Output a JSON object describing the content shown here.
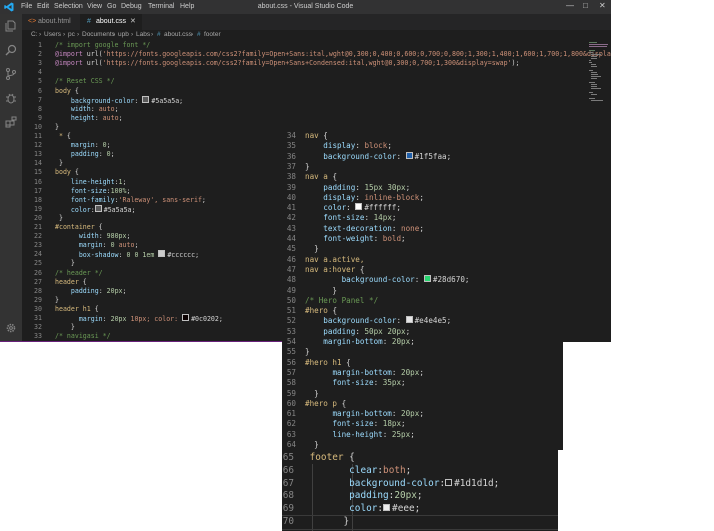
{
  "window": {
    "title": "about.css - Visual Studio Code",
    "menu": [
      "File",
      "Edit",
      "Selection",
      "View",
      "Go",
      "Debug",
      "Terminal",
      "Help"
    ]
  },
  "tabs": [
    {
      "label": "about.html",
      "icon": "html-file-icon",
      "active": false
    },
    {
      "label": "about.css",
      "icon": "css-file-icon",
      "active": true
    }
  ],
  "breadcrumb": [
    "C:",
    "Users",
    "pc",
    "Documents",
    "upb",
    "Labs",
    "about.css",
    "footer"
  ],
  "colors": {
    "accent": "#007acc",
    "background": "#1e1e1e",
    "swatch_5a5a5a": "#5a5a5a",
    "swatch_cccccc": "#cccccc",
    "swatch_0c0202": "#0c0202",
    "swatch_1f5faa": "#1f5faa",
    "swatch_ffffff": "#ffffff",
    "swatch_28d670": "#28d670",
    "swatch_e4e4e5": "#e4e4e5",
    "swatch_1d1d1d": "#1d1d1d",
    "swatch_eee": "#eeeeee"
  },
  "editor_main": {
    "lines": [
      {
        "n": "1",
        "text": "/* import google font */"
      },
      {
        "n": "2",
        "text": "@import url('https://fonts.googleapis.com/css2?family=Open+Sans:ital,wght@0,300;0,400;0,600;0,700;0,800;1,300;1,400;1,600;1,700;1,800&display=swa"
      },
      {
        "n": "3",
        "text": "@import url('https://fonts.googleapis.com/css2?family=Open+Sans+Condensed:ital,wght@0,300;0,700;1,300&display=swap');"
      },
      {
        "n": "4",
        "text": ""
      },
      {
        "n": "5",
        "text": "/* Reset CSS */"
      },
      {
        "n": "6",
        "text": "body {"
      },
      {
        "n": "7",
        "text": "    background-color: #5a5a5a;"
      },
      {
        "n": "8",
        "text": "    width: auto;"
      },
      {
        "n": "9",
        "text": "    height: auto;"
      },
      {
        "n": "10",
        "text": "}"
      },
      {
        "n": "11",
        "text": " * {"
      },
      {
        "n": "12",
        "text": "    margin: 0;"
      },
      {
        "n": "13",
        "text": "    padding: 0;"
      },
      {
        "n": "14",
        "text": " }"
      },
      {
        "n": "15",
        "text": "body {"
      },
      {
        "n": "16",
        "text": "    line-height:1;"
      },
      {
        "n": "17",
        "text": "    font-size:100%;"
      },
      {
        "n": "18",
        "text": "    font-family:'Raleway', sans-serif;"
      },
      {
        "n": "19",
        "text": "    color:#5a5a5a;"
      },
      {
        "n": "20",
        "text": " }"
      },
      {
        "n": "21",
        "text": "#container {"
      },
      {
        "n": "22",
        "text": "      width: 980px;"
      },
      {
        "n": "23",
        "text": "      margin: 0 auto;"
      },
      {
        "n": "24",
        "text": "      box-shadow: 0 0 1em #cccccc;"
      },
      {
        "n": "25",
        "text": "    }"
      },
      {
        "n": "26",
        "text": "/* header */"
      },
      {
        "n": "27",
        "text": "header {"
      },
      {
        "n": "28",
        "text": "    padding: 20px;"
      },
      {
        "n": "29",
        "text": "}"
      },
      {
        "n": "30",
        "text": "header h1 {"
      },
      {
        "n": "31",
        "text": "      margin: 20px 10px; color: #0c0202;"
      },
      {
        "n": "32",
        "text": "    }"
      },
      {
        "n": "33",
        "text": "/* navigasi */"
      }
    ]
  },
  "editor_nav": {
    "lines": [
      {
        "n": "34",
        "text": "nav {"
      },
      {
        "n": "35",
        "text": "    display: block;"
      },
      {
        "n": "36",
        "text": "    background-color: #1f5faa;"
      },
      {
        "n": "37",
        "text": "}"
      },
      {
        "n": "38",
        "text": "nav a {"
      },
      {
        "n": "39",
        "text": "    padding: 15px 30px;"
      },
      {
        "n": "40",
        "text": "    display: inline-block;"
      },
      {
        "n": "41",
        "text": "    color: #ffffff;"
      },
      {
        "n": "42",
        "text": "    font-size: 14px;"
      },
      {
        "n": "43",
        "text": "    text-decoration: none;"
      },
      {
        "n": "44",
        "text": "    font-weight: bold;"
      },
      {
        "n": "45",
        "text": "  }"
      },
      {
        "n": "46",
        "text": "nav a.active,"
      },
      {
        "n": "47",
        "text": "nav a:hover {"
      },
      {
        "n": "48",
        "text": "        background-color: #28d670;"
      },
      {
        "n": "49",
        "text": "      }"
      },
      {
        "n": "50",
        "text": "/* Hero Panel */"
      },
      {
        "n": "51",
        "text": "#hero {"
      },
      {
        "n": "52",
        "text": "    background-color: #e4e4e5;"
      },
      {
        "n": "53",
        "text": "    padding: 50px 20px;"
      },
      {
        "n": "54",
        "text": "    margin-bottom: 20px;"
      },
      {
        "n": "55",
        "text": "}"
      },
      {
        "n": "56",
        "text": "#hero h1 {"
      },
      {
        "n": "57",
        "text": "      margin-bottom: 20px;"
      },
      {
        "n": "58",
        "text": "      font-size: 35px;"
      },
      {
        "n": "59",
        "text": "  }"
      },
      {
        "n": "60",
        "text": "#hero p {"
      },
      {
        "n": "61",
        "text": "      margin-bottom: 20px;"
      },
      {
        "n": "62",
        "text": "      font-size: 18px;"
      },
      {
        "n": "63",
        "text": "      line-height: 25px;"
      },
      {
        "n": "64",
        "text": "  }"
      }
    ]
  },
  "editor_footer": {
    "lines": [
      {
        "n": "65",
        "text": " footer {"
      },
      {
        "n": "66",
        "text": "        clear:both;"
      },
      {
        "n": "67",
        "text": "        background-color:#1d1d1d;"
      },
      {
        "n": "68",
        "text": "        padding:20px;"
      },
      {
        "n": "69",
        "text": "        color:#eee;"
      },
      {
        "n": "70",
        "text": "       }"
      }
    ]
  }
}
